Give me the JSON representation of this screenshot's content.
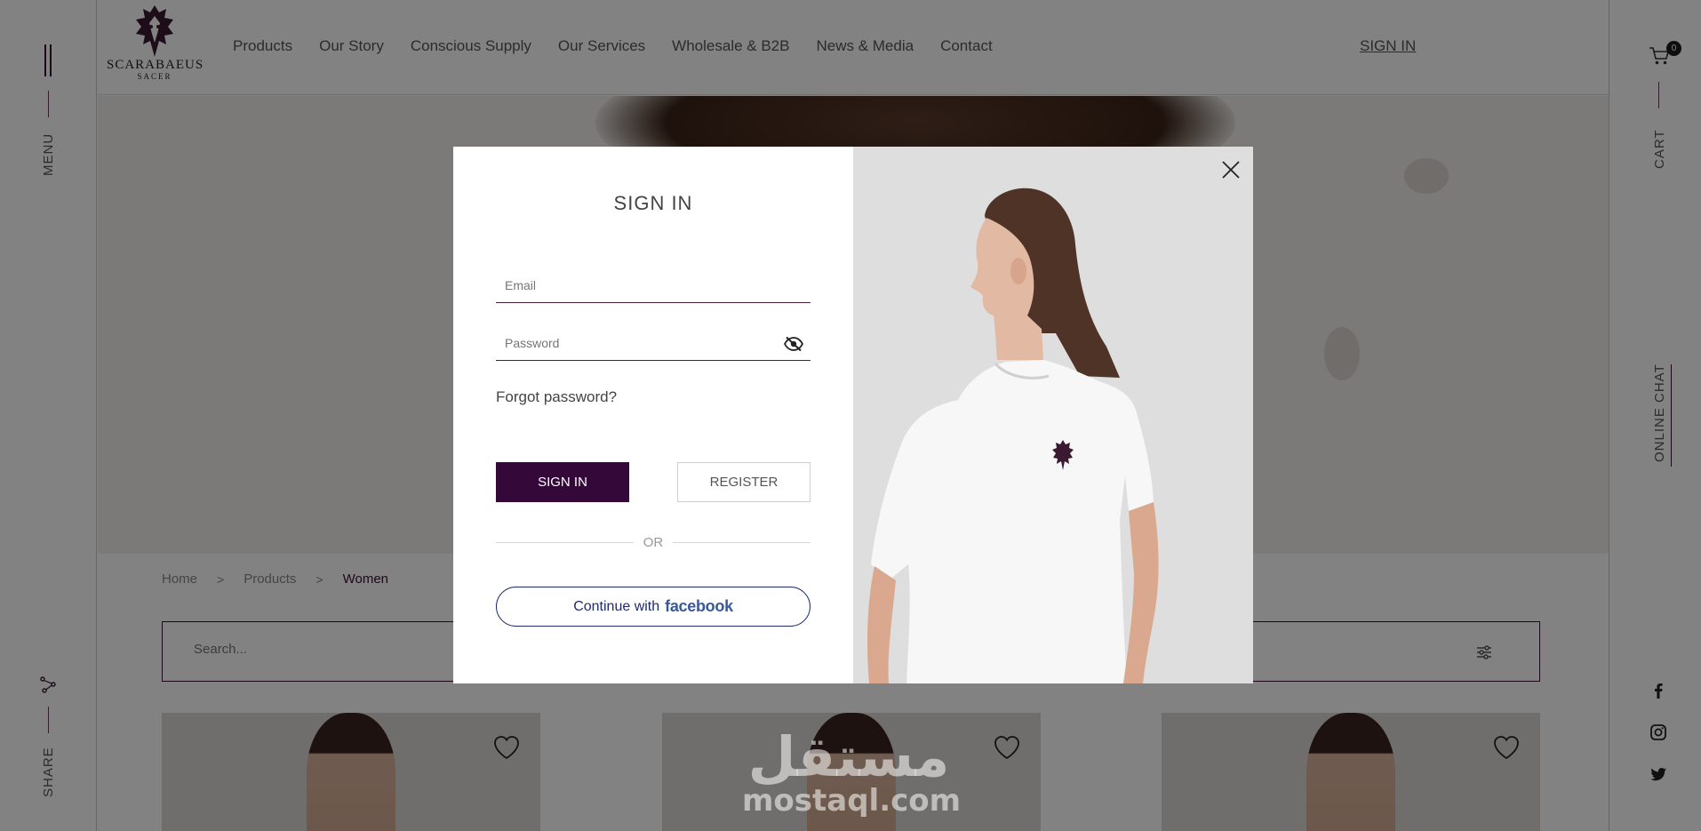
{
  "brand": {
    "name": "SCARABAEUS",
    "sub": "SACER"
  },
  "nav": {
    "items": [
      "Products",
      "Our Story",
      "Conscious Supply",
      "Our Services",
      "Wholesale & B2B",
      "News & Media",
      "Contact"
    ],
    "sign_in": "SIGN IN"
  },
  "left_rail": {
    "menu_label": "MENU",
    "share_label": "SHARE"
  },
  "right_rail": {
    "cart_label": "CART",
    "cart_count": "0",
    "chat_label": "ONLINE CHAT",
    "social_icons": [
      "facebook-icon",
      "instagram-icon",
      "twitter-icon"
    ]
  },
  "breadcrumb": {
    "items": [
      "Home",
      "Products"
    ],
    "current": "Women",
    "separator": ">"
  },
  "search": {
    "placeholder": "Search..."
  },
  "watermark": {
    "arabic": "مستقل",
    "latin": "mostaql.com"
  },
  "modal": {
    "title": "SIGN IN",
    "email_placeholder": "Email",
    "password_placeholder": "Password",
    "forgot": "Forgot password?",
    "sign_in_button": "SIGN IN",
    "register_button": "REGISTER",
    "or": "OR",
    "facebook_prefix": "Continue with",
    "facebook_brand": "facebook"
  },
  "colors": {
    "brand_purple": "#34093a",
    "overlay": "rgba(0,0,0,0.49)",
    "facebook_blue": "#3b5998"
  }
}
